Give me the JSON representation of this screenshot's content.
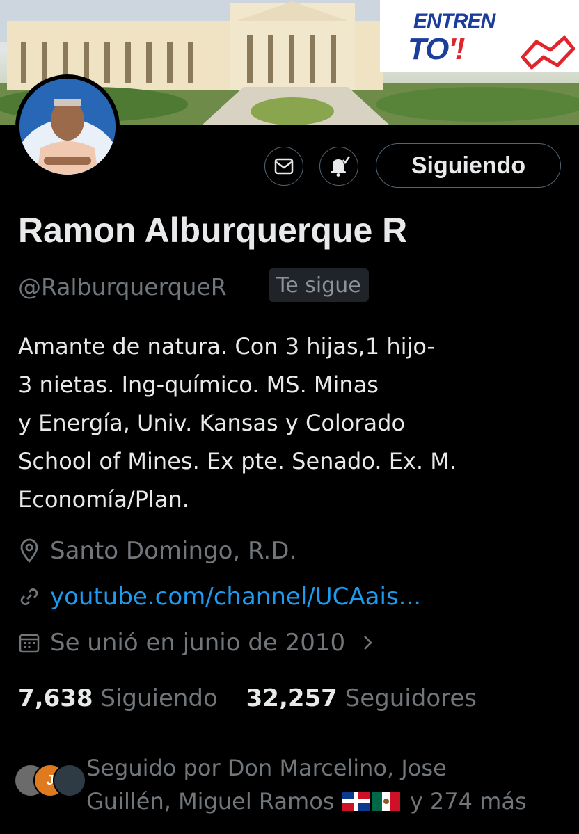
{
  "banner": {
    "promo_line1": "ENTREN",
    "promo_line2": "TO",
    "promo_mark": "'!"
  },
  "profile": {
    "display_name": "Ramon Alburquerque R",
    "handle": "@RalburquerqueR",
    "follows_you": "Te sigue",
    "bio_lines": [
      "Amante de natura. Con 3 hijas,1 hijo-",
      "3 nietas. Ing-químico. MS. Minas",
      "y Energía, Univ. Kansas y Colorado",
      "School of Mines. Ex pte. Senado. Ex. M.",
      "Economía/Plan."
    ],
    "location": "Santo Domingo, R.D.",
    "website": "youtube.com/channel/UCAais...",
    "joined": "Se unió en junio de 2010"
  },
  "actions": {
    "follow_state": "Siguiendo",
    "message_icon": "envelope-icon",
    "notify_icon": "bell-check-icon"
  },
  "stats": {
    "following_count": "7,638",
    "following_label": "Siguiendo",
    "followers_count": "32,257",
    "followers_label": "Seguidores"
  },
  "followed_by": {
    "line1": "Seguido por Don Marcelino, Jose",
    "line2_prefix": "Guillén, Miguel Ramos",
    "line2_suffix": "y 274 más",
    "flags": [
      "dominican-republic-flag",
      "mexico-flag"
    ]
  },
  "colors": {
    "background": "#000000",
    "text_primary": "#e7e9ea",
    "text_secondary": "#71767b",
    "link": "#1d9bf0",
    "border": "#536471"
  }
}
